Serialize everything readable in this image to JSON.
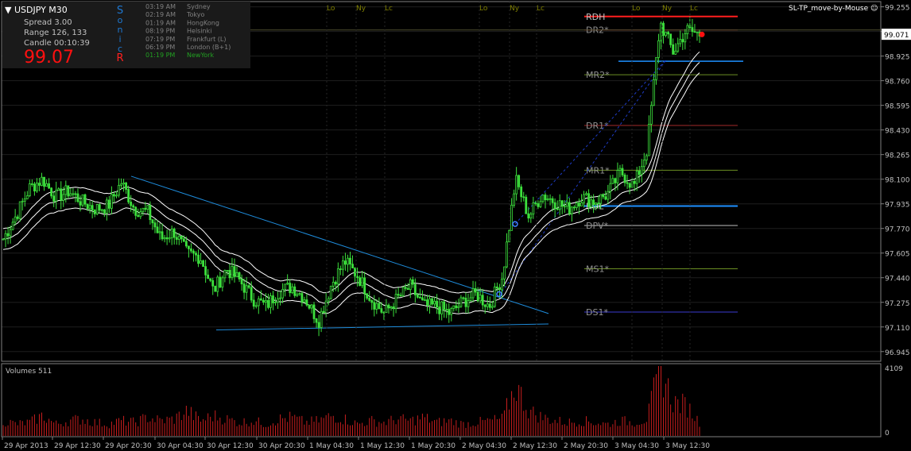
{
  "symbol": "USDJPY",
  "timeframe": "M30",
  "info": {
    "spread_label": "Spread",
    "spread_value": "3.00",
    "range_label": "Range",
    "range_value": "126, 133",
    "candle_label": "Candle",
    "candle_value": "00:10:39",
    "price": "99.07"
  },
  "sonicr_letters": [
    "S",
    "o",
    "n",
    "i",
    "c",
    "R"
  ],
  "sessions": [
    {
      "time": "03:19 AM",
      "name": "Sydney",
      "color": "#808080"
    },
    {
      "time": "02:19 AM",
      "name": "Tokyo",
      "color": "#808080"
    },
    {
      "time": "01:19 AM",
      "name": "HongKong",
      "color": "#808080"
    },
    {
      "time": "08:19 PM",
      "name": "Helsinki",
      "color": "#808080"
    },
    {
      "time": "07:19 PM",
      "name": "Frankfurt  (L)",
      "color": "#808080"
    },
    {
      "time": "06:19 PM",
      "name": "London  (B+1)",
      "color": "#808080"
    },
    {
      "time": "01:19 PM",
      "name": "NewYork",
      "color": "#22a022"
    }
  ],
  "top_markers": [
    "Lo",
    "Ny",
    "Lc",
    "Lo",
    "Ny",
    "Lc",
    "Lo",
    "Ny",
    "Lc"
  ],
  "indicator_name": "SL-TP_move-by-Mouse",
  "volume_label": "Volumes 511",
  "volume_axis": [
    "4109",
    "0"
  ],
  "colors": {
    "candle": "#3ce03c",
    "volume": "#c81e1e",
    "trendline": "#1e8cdc",
    "ema": "#ffffff",
    "sonicr": "#1e78d2",
    "sonicr_last": "#ff2020",
    "price_red": "#ff1010",
    "grid": "#1e1e1e"
  },
  "levels": [
    {
      "label": "RDH",
      "value": 99.19,
      "color": "#ff1e1e",
      "label_color": "#c0c0c0"
    },
    {
      "label": "DR2*",
      "value": 99.1,
      "color": "#a52a2a",
      "label_color": "#909090"
    },
    {
      "label": "MR2*",
      "value": 98.8,
      "color": "#6b8e23",
      "label_color": "#909090"
    },
    {
      "label": "DR1*",
      "value": 98.46,
      "color": "#a52a2a",
      "label_color": "#909090"
    },
    {
      "label": "MR1*",
      "value": 98.16,
      "color": "#6b8e23",
      "label_color": "#909090"
    },
    {
      "label": "RDL",
      "value": 97.92,
      "color": "#1e90ff",
      "label_color": "#c0c0c0"
    },
    {
      "label": "DPV*",
      "value": 97.79,
      "color": "#c0c0c0",
      "label_color": "#909090"
    },
    {
      "label": "MS1*",
      "value": 97.5,
      "color": "#6b8e23",
      "label_color": "#909090"
    },
    {
      "label": "DS1*",
      "value": 97.21,
      "color": "#3a3ad0",
      "label_color": "#909090"
    }
  ],
  "chart_data": {
    "type": "candlestick",
    "title": "USDJPY M30",
    "ylim": [
      96.88,
      99.29
    ],
    "y_ticks": [
      "99.255",
      "99.090",
      "98.925",
      "98.760",
      "98.595",
      "98.430",
      "98.265",
      "98.100",
      "97.935",
      "97.770",
      "97.605",
      "97.440",
      "97.275",
      "97.110",
      "96.945"
    ],
    "last_price": "99.071",
    "x_ticks": [
      "29 Apr 2013",
      "29 Apr 12:30",
      "29 Apr 20:30",
      "30 Apr 04:30",
      "30 Apr 12:30",
      "30 Apr 20:30",
      "1 May 04:30",
      "1 May 12:30",
      "1 May 20:30",
      "2 May 04:30",
      "2 May 12:30",
      "2 May 20:30",
      "3 May 04:30",
      "3 May 12:30"
    ],
    "close_path": [
      97.7,
      97.86,
      98.04,
      98.1,
      97.98,
      98.02,
      97.95,
      97.9,
      97.92,
      98.08,
      97.9,
      97.88,
      97.7,
      97.75,
      97.6,
      97.58,
      97.35,
      97.5,
      97.42,
      97.3,
      97.25,
      97.35,
      97.38,
      97.3,
      97.15,
      97.4,
      97.55,
      97.45,
      97.3,
      97.2,
      97.3,
      97.38,
      97.25,
      97.25,
      97.2,
      97.28,
      97.33,
      97.25,
      97.45,
      98.1,
      97.85,
      98.0,
      97.95,
      97.9,
      97.98,
      97.95,
      98.0,
      98.15,
      98.05,
      98.3,
      99.15,
      98.95,
      99.1,
      99.07
    ],
    "volume_path": [
      900,
      700,
      800,
      1200,
      700,
      900,
      1000,
      800,
      700,
      900,
      800,
      1100,
      900,
      1000,
      1500,
      900,
      1200,
      1000,
      800,
      900,
      700,
      1000,
      1100,
      800,
      900,
      1200,
      1000,
      700,
      900,
      800,
      1000,
      900,
      1100,
      800,
      900,
      700,
      800,
      900,
      1000,
      3000,
      1500,
      1100,
      900,
      800,
      900,
      800,
      700,
      900,
      800,
      1000,
      4000,
      2000,
      1800,
      800
    ]
  }
}
